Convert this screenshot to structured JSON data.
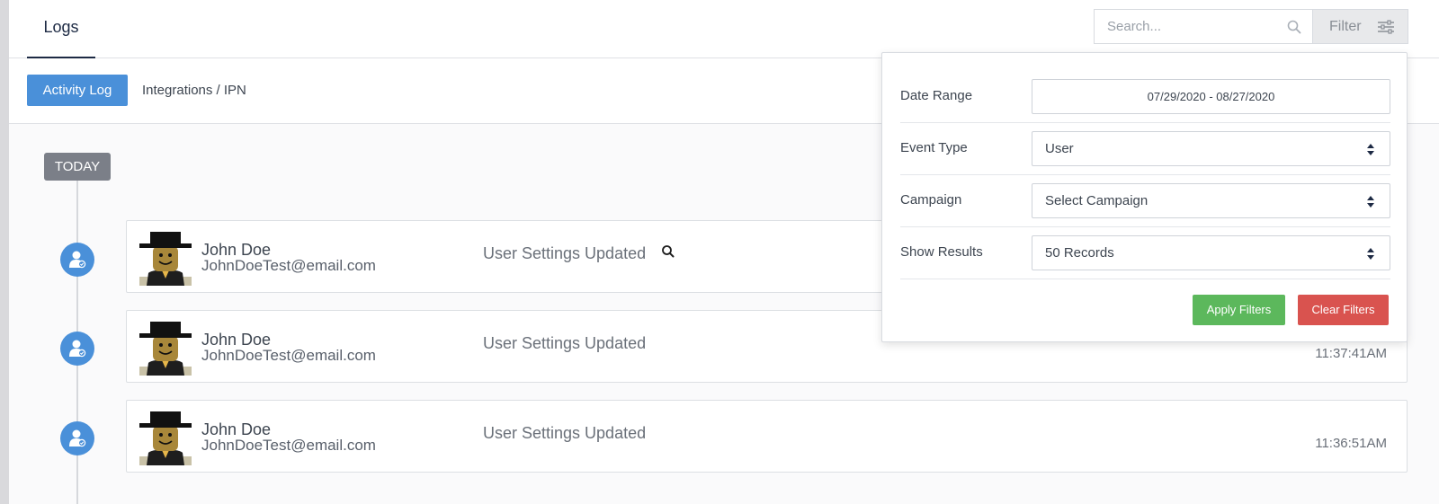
{
  "header": {
    "tab_logs": "Logs",
    "search_placeholder": "Search...",
    "filter_label": "Filter"
  },
  "subnav": {
    "activity_log": "Activity Log",
    "integrations": "Integrations / IPN"
  },
  "timeline": {
    "group_label": "TODAY",
    "entries": [
      {
        "name": "John Doe",
        "email": "JohnDoeTest@email.com",
        "event": "User Settings Updated",
        "time": ""
      },
      {
        "name": "John Doe",
        "email": "JohnDoeTest@email.com",
        "event": "User Settings Updated",
        "time": "11:37:41AM"
      },
      {
        "name": "John Doe",
        "email": "JohnDoeTest@email.com",
        "event": "User Settings Updated",
        "time": "11:36:51AM"
      }
    ]
  },
  "filter_panel": {
    "date_range_label": "Date Range",
    "date_range_value": "07/29/2020 - 08/27/2020",
    "event_type_label": "Event Type",
    "event_type_value": "User",
    "campaign_label": "Campaign",
    "campaign_value": "Select Campaign",
    "show_results_label": "Show Results",
    "show_results_value": "50 Records",
    "apply_label": "Apply Filters",
    "clear_label": "Clear Filters"
  },
  "colors": {
    "primary": "#4a90d9",
    "apply": "#5cb85c",
    "clear": "#d9534f",
    "badge": "#7b7f88"
  }
}
